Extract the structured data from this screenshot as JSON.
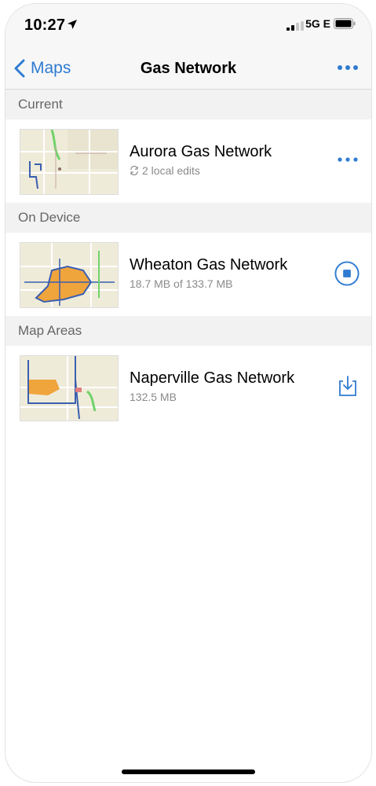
{
  "status_bar": {
    "time": "10:27",
    "network": "5G E"
  },
  "nav": {
    "back_label": "Maps",
    "title": "Gas Network"
  },
  "sections": [
    {
      "header": "Current",
      "items": [
        {
          "title": "Aurora Gas Network",
          "subtitle": "2 local edits",
          "action_icon": "more-icon"
        }
      ]
    },
    {
      "header": "On Device",
      "items": [
        {
          "title": "Wheaton Gas Network",
          "subtitle": "18.7 MB of 133.7 MB",
          "action_icon": "stop-download-icon"
        }
      ]
    },
    {
      "header": "Map Areas",
      "items": [
        {
          "title": "Naperville Gas Network",
          "subtitle": "132.5 MB",
          "action_icon": "download-icon"
        }
      ]
    }
  ],
  "colors": {
    "accent": "#2f7bd1",
    "header_bg": "#f2f2f2",
    "subtitle": "#8a8a8a"
  }
}
